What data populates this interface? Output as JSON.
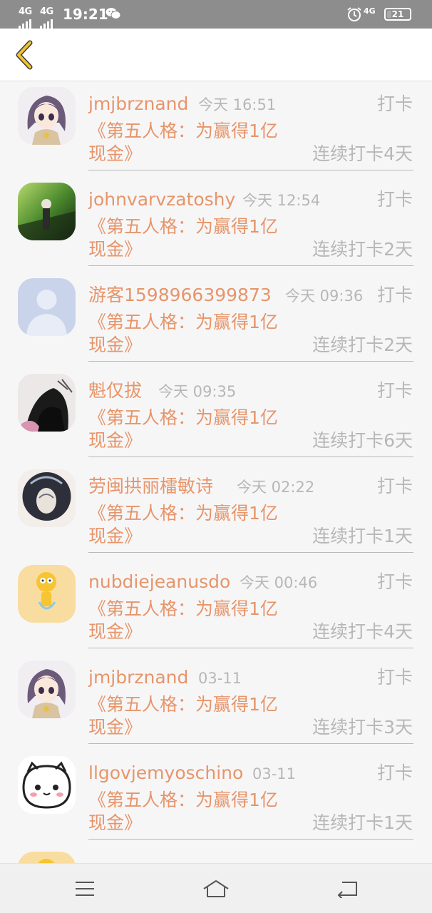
{
  "status_bar": {
    "signal_left_1": "4G",
    "signal_left_2": "4G",
    "time": "19:21",
    "signal_right": "4G",
    "battery": "21",
    "battery_level_percent": 21
  },
  "header": {
    "back_icon": "chevron-left-icon",
    "accent_color": "#f2c230"
  },
  "list": {
    "items": [
      {
        "username": "jmjbrznand",
        "time": "今天 16:51",
        "action": "打卡",
        "title_line1": "《第五人格：为赢得1亿",
        "title_line2": "现金》",
        "streak": "连续打卡4天"
      },
      {
        "username": "johnvarvzatoshy",
        "time": "今天 12:54",
        "action": "打卡",
        "title_line1": "《第五人格：为赢得1亿",
        "title_line2": "现金》",
        "streak": "连续打卡2天"
      },
      {
        "username": "游客1598966399873",
        "time": "今天 09:36",
        "action": "打卡",
        "title_line1": "《第五人格：为赢得1亿",
        "title_line2": "现金》",
        "streak": "连续打卡2天"
      },
      {
        "username": "魁仅拔",
        "time": "今天 09:35",
        "action": "打卡",
        "title_line1": "《第五人格：为赢得1亿",
        "title_line2": "现金》",
        "streak": "连续打卡6天"
      },
      {
        "username": "劳闽拱丽檑敏诗",
        "time": "今天 02:22",
        "action": "打卡",
        "title_line1": "《第五人格：为赢得1亿",
        "title_line2": "现金》",
        "streak": "连续打卡1天"
      },
      {
        "username": "nubdiejeanusdo",
        "time": "今天 00:46",
        "action": "打卡",
        "title_line1": "《第五人格：为赢得1亿",
        "title_line2": "现金》",
        "streak": "连续打卡4天"
      },
      {
        "username": "jmjbrznand",
        "time": "03-11",
        "action": "打卡",
        "title_line1": "《第五人格：为赢得1亿",
        "title_line2": "现金》",
        "streak": "连续打卡3天"
      },
      {
        "username": "llgovjemyoschino",
        "time": "03-11",
        "action": "打卡",
        "title_line1": "《第五人格：为赢得1亿",
        "title_line2": "现金》",
        "streak": "连续打卡1天"
      }
    ]
  },
  "colors": {
    "accent_orange": "#e6956a",
    "muted_gray": "#b7b7b7",
    "background": "#f7f6f7"
  },
  "nav_bar": {
    "menu_icon": "menu-icon",
    "home_icon": "home-icon",
    "back_icon": "back-arrow-icon"
  }
}
